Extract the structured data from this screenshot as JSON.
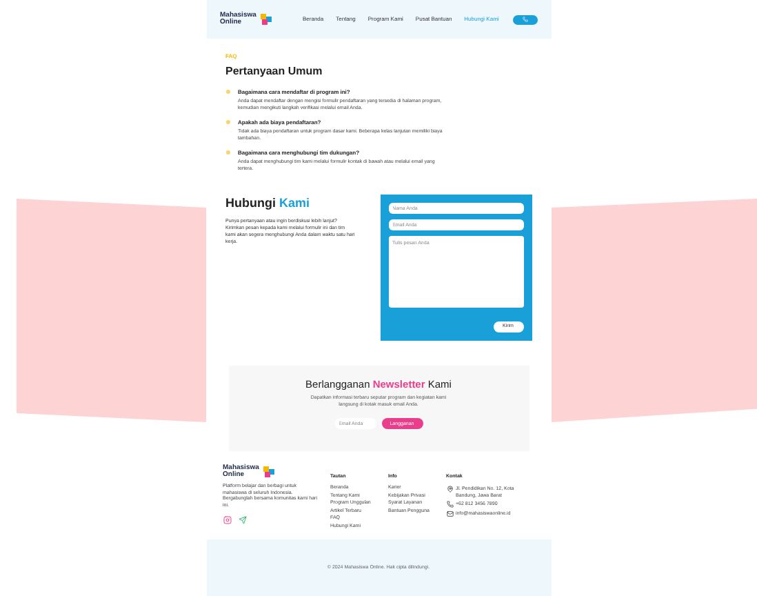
{
  "header": {
    "logo": "Mahasiswa Online",
    "nav": [
      {
        "label": "Beranda",
        "selected": false
      },
      {
        "label": "Tentang",
        "selected": false
      },
      {
        "label": "Program Kami",
        "selected": false
      },
      {
        "label": "Pusat Bantuan",
        "selected": false
      },
      {
        "label": "Hubungi Kami",
        "selected": true
      }
    ]
  },
  "faq": {
    "eyebrow": "FAQ",
    "title": "Pertanyaan Umum",
    "items": [
      {
        "question": "Bagaimana cara mendaftar di program ini?",
        "answer": "Anda dapat mendaftar dengan mengisi formulir pendaftaran yang tersedia di halaman program, kemudian mengikuti langkah verifikasi melalui email Anda."
      },
      {
        "question": "Apakah ada biaya pendaftaran?",
        "answer": "Tidak ada biaya pendaftaran untuk program dasar kami. Beberapa kelas lanjutan memiliki biaya tambahan."
      },
      {
        "question": "Bagaimana cara menghubungi tim dukungan?",
        "answer": "Anda dapat menghubungi tim kami melalui formulir kontak di bawah atau melalui email yang tertera."
      }
    ]
  },
  "contact": {
    "title": "Hubungi",
    "title_accent": "Kami",
    "text": "Punya pertanyaan atau ingin berdiskusi lebih lanjut? Kirimkan pesan kepada kami melalui formulir ini dan tim kami akan segera menghubungi Anda dalam waktu satu hari kerja.",
    "fields": [
      {
        "placeholder": "Nama Anda"
      },
      {
        "placeholder": "Email Anda"
      }
    ],
    "message_placeholder": "Tulis pesan Anda",
    "submit": "Kirim"
  },
  "newsletter": {
    "title": "Berlangganan",
    "title_accent": "Newsletter",
    "title_end": "Kami",
    "text": "Dapatkan informasi terbaru seputar program dan kegiatan kami langsung di kotak masuk email Anda.",
    "placeholder": "Email Anda",
    "button": "Langganan"
  },
  "footer": {
    "logo": "Mahasiswa Online",
    "description": "Platform belajar dan berbagi untuk mahasiswa di seluruh Indonesia. Bergabunglah bersama komunitas kami hari ini.",
    "columns": [
      {
        "title": "Tautan",
        "links": [
          "Beranda",
          "Tentang Kami",
          "Program Unggulan",
          "Artikel Terbaru",
          "FAQ",
          "Hubungi Kami"
        ]
      },
      {
        "title": "Info",
        "links": [
          "Karier",
          "Kebijakan Privasi",
          "Syarat Layanan",
          "Bantuan Pengguna"
        ]
      }
    ],
    "contact_title": "Kontak",
    "contacts": [
      {
        "kind": "location",
        "text": "Jl. Pendidikan No. 12, Kota Bandung, Jawa Barat"
      },
      {
        "kind": "phone",
        "text": "+62 812 3456 7890"
      },
      {
        "kind": "mail",
        "text": "info@mahasiswaonline.id"
      }
    ],
    "copyright": "© 2024 Mahasiswa Online. Hak cipta dilindungi."
  }
}
